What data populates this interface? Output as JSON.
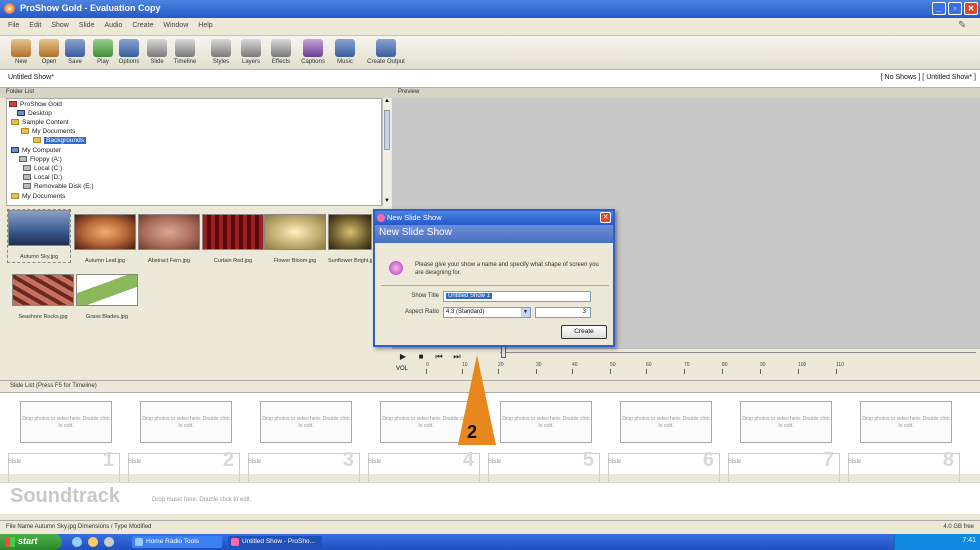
{
  "window": {
    "title": "ProShow Gold - Evaluation Copy"
  },
  "menu": [
    "File",
    "Edit",
    "Show",
    "Slide",
    "Audio",
    "Create",
    "Window",
    "Help"
  ],
  "toolbar": [
    "New",
    "Open",
    "Save",
    "Play",
    "Options",
    "Slide",
    "Timeline",
    "Styles",
    "Layers",
    "Effects",
    "Captions",
    "Music",
    "Create Output"
  ],
  "show_tabs": {
    "current": "Untitled Show*",
    "right": "[ No Shows ]  [ Untitled Show* ]"
  },
  "folders_header": "Folder List",
  "preview_header": "Preview",
  "tree": [
    {
      "label": "ProShow Gold",
      "level": 0
    },
    {
      "label": "Desktop",
      "level": 1
    },
    {
      "label": "Sample Content",
      "level": 1
    },
    {
      "label": "My Documents",
      "level": 2
    },
    {
      "label": "Backgrounds",
      "level": 3,
      "selected": true
    },
    {
      "label": "My Computer",
      "level": 1
    },
    {
      "label": "Floppy (A:)",
      "level": 2
    },
    {
      "label": "Local (C:)",
      "level": 2
    },
    {
      "label": "Local (D:)",
      "level": 2
    },
    {
      "label": "Removable Disk (E:)",
      "level": 2
    },
    {
      "label": "My Documents",
      "level": 1
    }
  ],
  "thumbnails": [
    {
      "caption": "Autumn Sky.jpg",
      "color": "#3a5a8e"
    },
    {
      "caption": "Autumn Leaf.jpg",
      "color": "#b86a3a"
    },
    {
      "caption": "Abstract Fern.jpg",
      "color": "#a86a5a"
    },
    {
      "caption": "Curtain Red.jpg",
      "color": "#7a1818"
    },
    {
      "caption": "Flower Bloom.jpg",
      "color": "#c8b478"
    },
    {
      "caption": "Sunflower Bright.jpg",
      "color": "#6a5a2a"
    },
    {
      "caption": "Seashore Rocks.jpg",
      "color": "#a85a4a"
    },
    {
      "caption": "Grass Blades.jpg",
      "color": "#8ab85a"
    }
  ],
  "dialog": {
    "title": "New Slide Show",
    "band": "New Slide Show",
    "message": "Please give your show a name and specify what shape of screen you are designing for.",
    "name_label": "Show Title",
    "name_value": "Untitled Show 1",
    "aspect_label": "Aspect Ratio",
    "aspect_value": "4:3 (Standard)",
    "spin_value": "3",
    "create_label": "Create"
  },
  "transport": {
    "volume_label": "VOL"
  },
  "ruler_ticks": [
    "0",
    "10",
    "20",
    "30",
    "40",
    "50",
    "60",
    "70",
    "80",
    "90",
    "100",
    "110"
  ],
  "slide_list_header": "Slide List (Press F5 for Timeline)",
  "slides": [
    {
      "num": "1",
      "label": "Slide",
      "text": "Drop photos or video here. Double click to edit."
    },
    {
      "num": "2",
      "label": "Slide",
      "text": "Drop photos or video here. Double click to edit."
    },
    {
      "num": "3",
      "label": "Slide",
      "text": "Drop photos or video here. Double click to edit."
    },
    {
      "num": "4",
      "label": "Slide",
      "text": "Drop photos or video here. Double click to edit."
    },
    {
      "num": "5",
      "label": "Slide",
      "text": "Drop photos or video here. Double click to edit."
    },
    {
      "num": "6",
      "label": "Slide",
      "text": "Drop photos or video here. Double click to edit."
    },
    {
      "num": "7",
      "label": "Slide",
      "text": "Drop photos or video here. Double click to edit."
    },
    {
      "num": "8",
      "label": "Slide",
      "text": "Drop photos or video here. Double click to edit."
    }
  ],
  "soundtrack": {
    "title": "Soundtrack",
    "hint": "Drop music here. Double click to edit."
  },
  "status": {
    "left": "File Name    Autumn Sky.jpg    Dimensions / Type    Modified",
    "right": "4.0 GB free"
  },
  "taskbar": {
    "start": "start",
    "tasks": [
      "Home Radio Tools",
      "Untitled Show - ProSho..."
    ],
    "tray": "7:41"
  },
  "annotation": {
    "label": "2",
    "color": "#e8871e"
  }
}
